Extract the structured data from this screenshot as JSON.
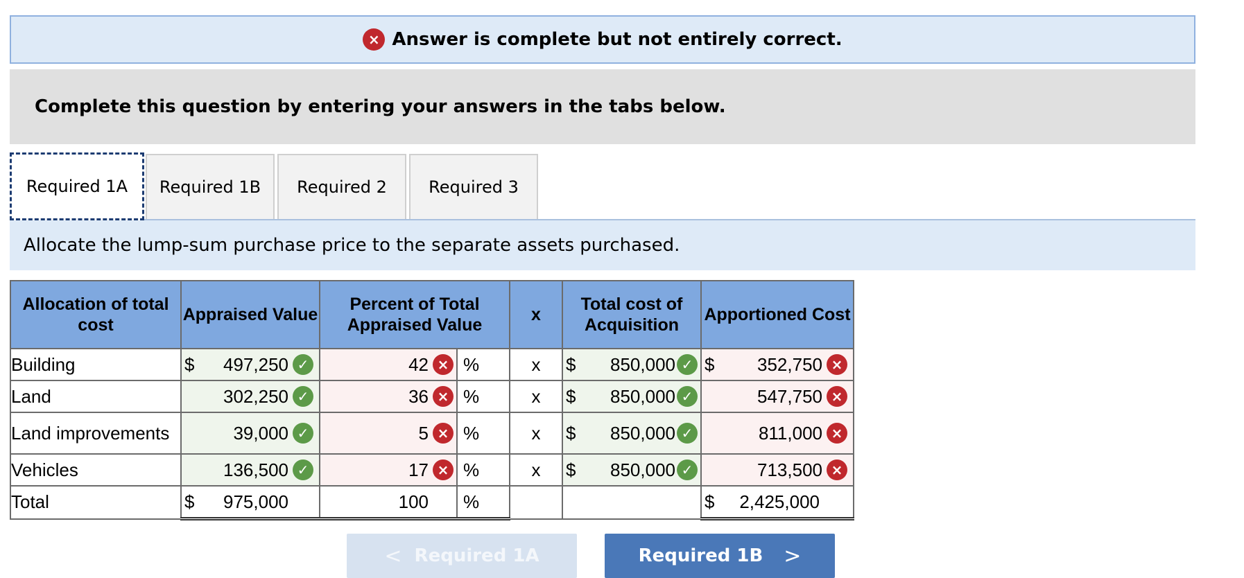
{
  "banner": {
    "text": "Answer is complete but not entirely correct.",
    "icon": "×"
  },
  "instruction": "Complete this question by entering your answers in the tabs below.",
  "tabs": [
    "Required 1A",
    "Required 1B",
    "Required 2",
    "Required 3"
  ],
  "prompt": "Allocate the lump-sum purchase price to the separate assets purchased.",
  "headers": {
    "allocation": "Allocation of total cost",
    "appraised": "Appraised Value",
    "percent": "Percent of Total Appraised Value",
    "x": "x",
    "total_cost": "Total cost of Acquisition",
    "apportioned": "Apportioned Cost"
  },
  "rows": [
    {
      "label": "Building",
      "appraised": "497,250",
      "percent": "42",
      "x": "x",
      "cost": "850,000",
      "apportioned": "352,750"
    },
    {
      "label": "Land",
      "appraised": "302,250",
      "percent": "36",
      "x": "x",
      "cost": "850,000",
      "apportioned": "547,750"
    },
    {
      "label": "Land improvements",
      "appraised": "39,000",
      "percent": "5",
      "x": "x",
      "cost": "850,000",
      "apportioned": "811,000"
    },
    {
      "label": "Vehicles",
      "appraised": "136,500",
      "percent": "17",
      "x": "x",
      "cost": "850,000",
      "apportioned": "713,500"
    }
  ],
  "total": {
    "label": "Total",
    "appraised": "975,000",
    "percent": "100",
    "apportioned": "2,425,000"
  },
  "symbols": {
    "dollar": "$",
    "percent": "%",
    "check": "✓",
    "cross": "×"
  },
  "buttons": {
    "prev": "Required 1A",
    "next": "Required 1B",
    "prev_chevron": "<",
    "next_chevron": ">"
  }
}
